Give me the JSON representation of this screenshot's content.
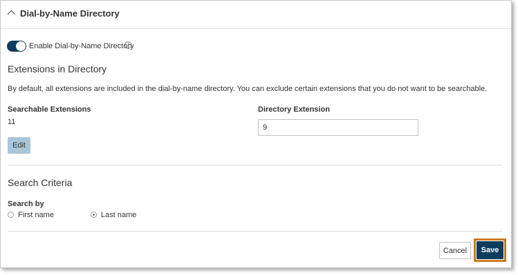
{
  "header": {
    "title": "Dial-by-Name Directory"
  },
  "toggle": {
    "label": "Enable Dial-by-Name Directory",
    "enabled": true
  },
  "extensions": {
    "title": "Extensions in Directory",
    "description": "By default, all extensions are included in the dial-by-name directory. You can exclude certain extensions that you do not want to be searchable.",
    "searchable_label": "Searchable Extensions",
    "searchable_value": "11",
    "edit_label": "Edit",
    "directory_ext_label": "Directory Extension",
    "directory_ext_value": "9"
  },
  "search": {
    "title": "Search Criteria",
    "by_label": "Search by",
    "options": [
      {
        "label": "First name",
        "selected": false
      },
      {
        "label": "Last name",
        "selected": true
      }
    ]
  },
  "footer": {
    "cancel_label": "Cancel",
    "save_label": "Save"
  },
  "colors": {
    "accent": "#0d3d5c",
    "edit_button": "#a9c5d8",
    "highlight": "#c97a1e"
  }
}
